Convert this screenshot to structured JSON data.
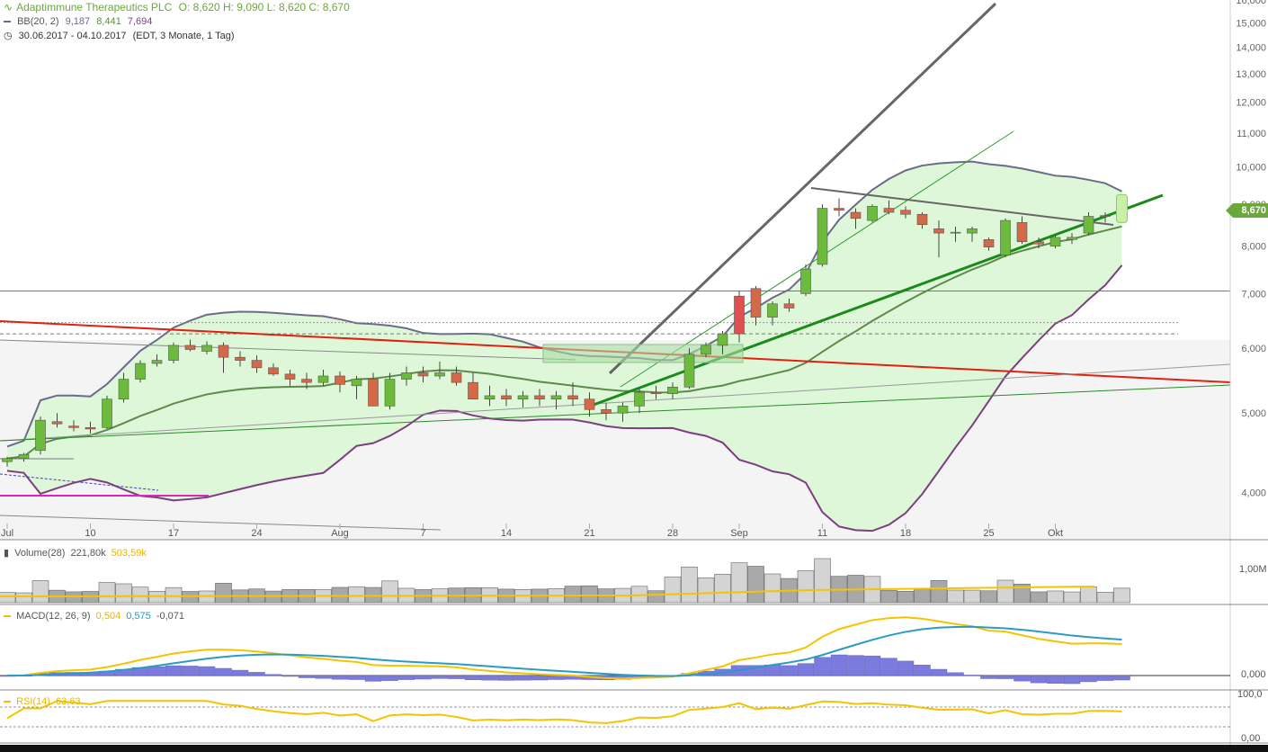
{
  "header": {
    "title": "Adaptimmune Therapeutics PLC",
    "ohlc": "O: 8,620  H: 9,090  L: 8,620  C: 8,670",
    "bb_label": "BB(20, 2)",
    "bb_values": [
      "9,187",
      "8,441",
      "7,694"
    ],
    "range": "30.06.2017 - 04.10.2017",
    "range_detail": "(EDT, 3 Monate, 1 Tag)"
  },
  "price_axis": [
    "16,000",
    "15,000",
    "14,000",
    "13,000",
    "12,000",
    "11,000",
    "10,000",
    "9,000",
    "8,000",
    "7,000",
    "6,000",
    "5,000",
    "4,000"
  ],
  "current_price": "8,670",
  "date_axis": [
    "Jul",
    "10",
    "17",
    "24",
    "Aug",
    "7",
    "14",
    "21",
    "28",
    "Sep",
    "11",
    "18",
    "25",
    "Okt"
  ],
  "volume": {
    "label": "Volume(28)",
    "v1": "221,80k",
    "v2": "503,59k",
    "axis": "1,00M"
  },
  "macd": {
    "label": "MACD(12, 26, 9)",
    "v1": "0,504",
    "v2": "0,575",
    "v3": "-0,071",
    "axis": "0,000"
  },
  "rsi": {
    "label": "RSI(14)",
    "v1": "63,63",
    "axis_top": "100,0",
    "axis_bottom": "0,00"
  },
  "colors": {
    "up": "#6dbb3c",
    "down": "#d4694a",
    "bb_outer_upper": "#6b6b8a",
    "bb_lower": "#7b3f7f",
    "bb_mid": "#5c8a4a",
    "macd": "#f5c400",
    "signal": "#2b9ac4",
    "hist": "#7b7bde",
    "rsi": "#f5c400"
  },
  "chart_data": {
    "type": "candlestick",
    "title": "Adaptimmune Therapeutics PLC",
    "x": [
      "06-30",
      "07-03",
      "07-05",
      "07-06",
      "07-07",
      "07-10",
      "07-11",
      "07-12",
      "07-13",
      "07-14",
      "07-17",
      "07-18",
      "07-19",
      "07-20",
      "07-21",
      "07-24",
      "07-25",
      "07-26",
      "07-27",
      "07-28",
      "07-31",
      "08-01",
      "08-02",
      "08-03",
      "08-04",
      "08-07",
      "08-08",
      "08-09",
      "08-10",
      "08-11",
      "08-14",
      "08-15",
      "08-16",
      "08-17",
      "08-18",
      "08-21",
      "08-22",
      "08-23",
      "08-24",
      "08-25",
      "08-28",
      "08-29",
      "08-30",
      "08-31",
      "09-01",
      "09-05",
      "09-06",
      "09-07",
      "09-08",
      "09-11",
      "09-12",
      "09-13",
      "09-14",
      "09-15",
      "09-18",
      "09-19",
      "09-20",
      "09-21",
      "09-22",
      "09-25",
      "09-26",
      "09-27",
      "09-28",
      "09-29",
      "10-02",
      "10-03",
      "10-04"
    ],
    "ohlc": [
      [
        4.36,
        4.42,
        4.3,
        4.4
      ],
      [
        4.4,
        4.47,
        4.36,
        4.45
      ],
      [
        4.5,
        4.95,
        4.45,
        4.9
      ],
      [
        4.88,
        5.0,
        4.8,
        4.85
      ],
      [
        4.82,
        4.9,
        4.75,
        4.8
      ],
      [
        4.8,
        4.88,
        4.72,
        4.78
      ],
      [
        4.8,
        5.25,
        4.78,
        5.2
      ],
      [
        5.2,
        5.6,
        5.15,
        5.5
      ],
      [
        5.5,
        5.8,
        5.45,
        5.75
      ],
      [
        5.75,
        5.9,
        5.7,
        5.8
      ],
      [
        5.8,
        6.1,
        5.75,
        6.05
      ],
      [
        6.05,
        6.15,
        5.95,
        5.98
      ],
      [
        5.95,
        6.12,
        5.9,
        6.05
      ],
      [
        6.05,
        6.1,
        5.6,
        5.85
      ],
      [
        5.85,
        5.95,
        5.7,
        5.8
      ],
      [
        5.8,
        5.88,
        5.6,
        5.68
      ],
      [
        5.68,
        5.75,
        5.55,
        5.58
      ],
      [
        5.58,
        5.65,
        5.4,
        5.5
      ],
      [
        5.5,
        5.6,
        5.35,
        5.45
      ],
      [
        5.45,
        5.65,
        5.4,
        5.55
      ],
      [
        5.55,
        5.62,
        5.3,
        5.42
      ],
      [
        5.4,
        5.55,
        5.2,
        5.5
      ],
      [
        5.5,
        5.6,
        5.3,
        5.1
      ],
      [
        5.1,
        5.6,
        5.05,
        5.5
      ],
      [
        5.5,
        5.7,
        5.4,
        5.6
      ],
      [
        5.6,
        5.7,
        5.45,
        5.55
      ],
      [
        5.55,
        5.78,
        5.5,
        5.6
      ],
      [
        5.6,
        5.7,
        5.4,
        5.45
      ],
      [
        5.45,
        5.6,
        5.3,
        5.2
      ],
      [
        5.2,
        5.4,
        5.1,
        5.25
      ],
      [
        5.25,
        5.35,
        5.1,
        5.2
      ],
      [
        5.2,
        5.32,
        5.08,
        5.25
      ],
      [
        5.25,
        5.35,
        5.1,
        5.2
      ],
      [
        5.2,
        5.32,
        5.05,
        5.25
      ],
      [
        5.25,
        5.45,
        5.1,
        5.2
      ],
      [
        5.2,
        5.3,
        4.95,
        5.05
      ],
      [
        5.05,
        5.15,
        4.9,
        5.0
      ],
      [
        5.0,
        5.15,
        4.88,
        5.1
      ],
      [
        5.1,
        5.35,
        5.0,
        5.3
      ],
      [
        5.3,
        5.4,
        5.2,
        5.28
      ],
      [
        5.28,
        5.45,
        5.2,
        5.38
      ],
      [
        5.38,
        6.0,
        5.35,
        5.9
      ],
      [
        5.9,
        6.1,
        5.85,
        6.05
      ],
      [
        6.05,
        6.3,
        5.9,
        6.25
      ],
      [
        6.25,
        7.05,
        6.1,
        6.95
      ],
      [
        7.1,
        7.15,
        6.4,
        6.55
      ],
      [
        6.55,
        6.85,
        6.4,
        6.8
      ],
      [
        6.8,
        6.9,
        6.65,
        6.72
      ],
      [
        7.0,
        7.6,
        6.95,
        7.5
      ],
      [
        7.6,
        9.0,
        7.55,
        8.9
      ],
      [
        8.9,
        9.15,
        8.7,
        8.85
      ],
      [
        8.8,
        8.9,
        8.4,
        8.65
      ],
      [
        8.6,
        9.0,
        8.55,
        8.95
      ],
      [
        8.9,
        9.1,
        8.75,
        8.8
      ],
      [
        8.85,
        8.95,
        8.65,
        8.75
      ],
      [
        8.75,
        8.8,
        8.4,
        8.5
      ],
      [
        8.4,
        8.6,
        7.75,
        8.3
      ],
      [
        8.3,
        8.45,
        8.1,
        8.32
      ],
      [
        8.3,
        8.45,
        8.1,
        8.4
      ],
      [
        8.15,
        8.2,
        7.9,
        7.98
      ],
      [
        7.8,
        8.65,
        7.75,
        8.6
      ],
      [
        8.55,
        8.7,
        8.05,
        8.1
      ],
      [
        8.1,
        8.2,
        7.95,
        8.05
      ],
      [
        8.0,
        8.25,
        7.95,
        8.2
      ],
      [
        8.15,
        8.3,
        8.05,
        8.2
      ],
      [
        8.3,
        8.8,
        8.25,
        8.7
      ],
      [
        8.7,
        8.8,
        8.55,
        8.72
      ],
      [
        8.62,
        9.09,
        8.62,
        8.67
      ]
    ],
    "ylim": [
      3.5,
      16
    ],
    "yscale": "log"
  }
}
